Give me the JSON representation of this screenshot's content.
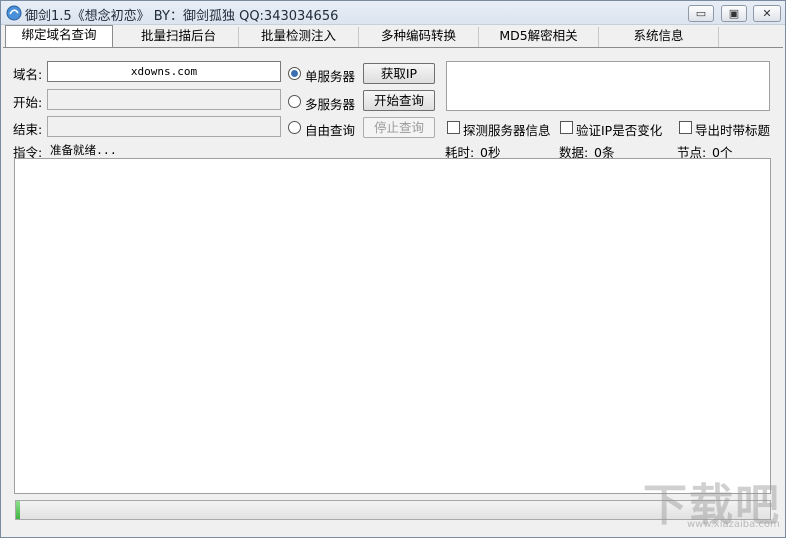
{
  "window": {
    "title": "御剑1.5《想念初恋》 BY：御剑孤独 QQ:343034656",
    "min_glyph": "▭",
    "max_glyph": "▣",
    "close_glyph": "✕"
  },
  "tabs": [
    {
      "label": "绑定域名查询",
      "active": true
    },
    {
      "label": "批量扫描后台"
    },
    {
      "label": "批量检测注入"
    },
    {
      "label": "多种编码转换"
    },
    {
      "label": "MD5解密相关"
    },
    {
      "label": "系统信息"
    }
  ],
  "form": {
    "domain_label": "域名:",
    "domain_value": "xdowns.com",
    "start_label": "开始:",
    "start_value": "",
    "end_label": "结束:",
    "end_value": ""
  },
  "mode": {
    "single_label": "单服务器",
    "multi_label": "多服务器",
    "free_label": "自由查询",
    "selected": "single"
  },
  "buttons": {
    "get_ip": "获取IP",
    "start_query": "开始查询",
    "stop_query": "停止查询"
  },
  "options": {
    "probe_server": "探测服务器信息",
    "verify_ip": "验证IP是否变化",
    "export_title": "导出时带标题"
  },
  "status": {
    "command_label": "指令:",
    "command_value": "准备就绪...",
    "elapsed_label": "耗时:",
    "elapsed_value": "0秒",
    "data_label": "数据:",
    "data_value": "0条",
    "node_label": "节点:",
    "node_value": "0个"
  },
  "progress": {
    "value": 0.005
  },
  "watermark": {
    "text": "下载吧",
    "url": "www.xiazaiba.com"
  },
  "colors": {
    "accent": "#3b6fb2",
    "progress": "#3fb43f"
  }
}
